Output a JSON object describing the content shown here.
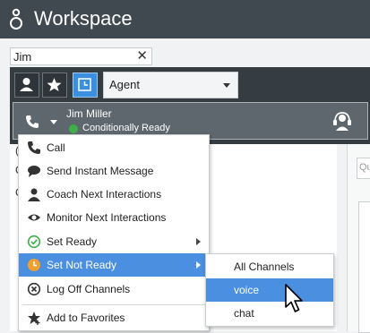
{
  "app": {
    "title": "Workspace"
  },
  "search": {
    "value": "Jim",
    "clear_icon": "✕"
  },
  "team_toolbar": {
    "role_select": {
      "selected": "Agent"
    }
  },
  "agent_card": {
    "name": "Jim Miller",
    "status": "Conditionally Ready",
    "status_color": "#3fae49"
  },
  "right_panel": {
    "input_placeholder": "Qu"
  },
  "menu": {
    "items": [
      {
        "label": "Call",
        "icon": "phone-icon"
      },
      {
        "label": "Send Instant Message",
        "icon": "chat-bubble-icon"
      },
      {
        "label": "Coach Next Interactions",
        "icon": "coach-icon"
      },
      {
        "label": "Monitor Next Interactions",
        "icon": "eye-icon"
      },
      {
        "label": "Set Ready",
        "icon": "ready-check-icon"
      },
      {
        "label": "Set Not Ready",
        "icon": "not-ready-clock-icon"
      },
      {
        "label": "Log Off Channels",
        "icon": "log-off-icon"
      },
      {
        "label": "Add to Favorites",
        "icon": "add-star-icon"
      }
    ]
  },
  "submenu": {
    "items": [
      {
        "label": "All Channels"
      },
      {
        "label": "voice"
      },
      {
        "label": "chat"
      }
    ]
  },
  "colors": {
    "header": "#404950",
    "panel": "#353c42",
    "accent": "#4a8fe0",
    "ready": "#3fae49",
    "not_ready": "#f0a030"
  }
}
